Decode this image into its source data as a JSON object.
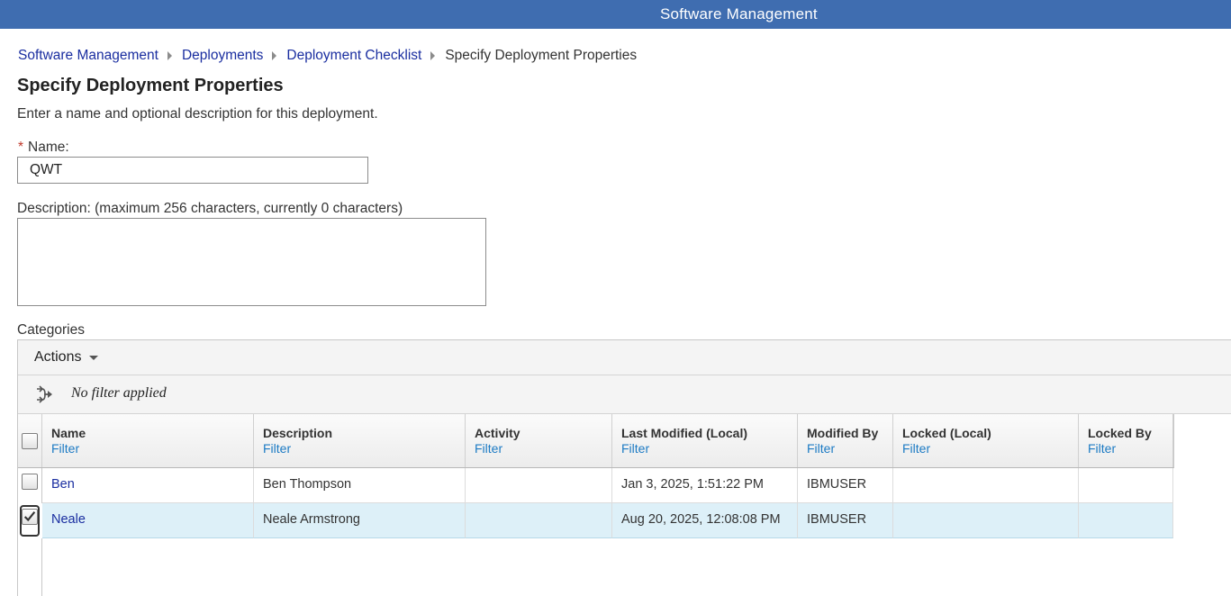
{
  "header": {
    "title": "Software Management"
  },
  "breadcrumb": {
    "items": [
      "Software Management",
      "Deployments",
      "Deployment Checklist"
    ],
    "current": "Specify Deployment Properties"
  },
  "page": {
    "title": "Specify Deployment Properties",
    "subtitle": "Enter a name and optional description for this deployment."
  },
  "form": {
    "name_required_marker": "*",
    "name_label": "Name:",
    "name_value": "QWT",
    "description_label": "Description: (maximum 256 characters, currently 0 characters)",
    "description_value": ""
  },
  "categories": {
    "label": "Categories",
    "actions_label": "Actions",
    "filter_status": "No filter applied",
    "filter_link": "Filter",
    "columns": [
      "Name",
      "Description",
      "Activity",
      "Last Modified (Local)",
      "Modified By",
      "Locked (Local)",
      "Locked By"
    ],
    "rows": [
      {
        "name": "Ben",
        "description": "Ben Thompson",
        "activity": "",
        "last_modified": "Jan 3, 2025, 1:51:22 PM",
        "modified_by": "IBMUSER",
        "locked": "",
        "locked_by": "",
        "selected": false
      },
      {
        "name": "Neale",
        "description": "Neale Armstrong",
        "activity": "",
        "last_modified": "Aug 20, 2025, 12:08:08 PM",
        "modified_by": "IBMUSER",
        "locked": "",
        "locked_by": "",
        "selected": true
      }
    ]
  },
  "colors": {
    "header_bg": "#3f6db0",
    "link": "#1a2ea0",
    "filter_link": "#1d7bc4",
    "selected_row": "#ddf0f8"
  },
  "icons": {
    "breadcrumb_separator": "triangle-right-icon",
    "actions_caret": "caret-down-icon",
    "filter": "filter-arrows-icon",
    "checkmark": "checkmark-icon"
  }
}
